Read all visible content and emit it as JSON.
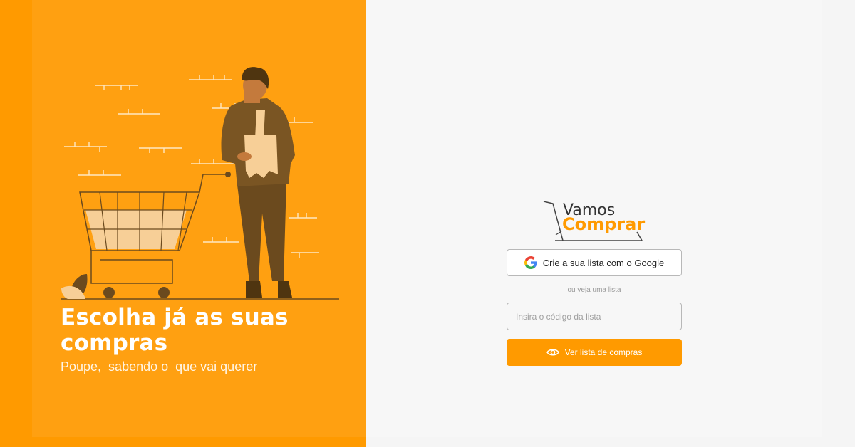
{
  "hero": {
    "headline": "Escolha já as suas compras",
    "subline": "Poupe,  sabendo o  que vai querer"
  },
  "logo": {
    "line1": "Vamos",
    "line2": "Comprar"
  },
  "google_button": {
    "label": "Crie a sua lista com o Google",
    "icon": "google-icon"
  },
  "divider": {
    "text": "ou veja uma lista"
  },
  "code_input": {
    "placeholder": "Insira o código da lista",
    "value": ""
  },
  "view_button": {
    "label": "Ver lista de compras",
    "icon": "eye-icon"
  },
  "colors": {
    "accent": "#ff9a00",
    "background": "#f7f7f7"
  }
}
